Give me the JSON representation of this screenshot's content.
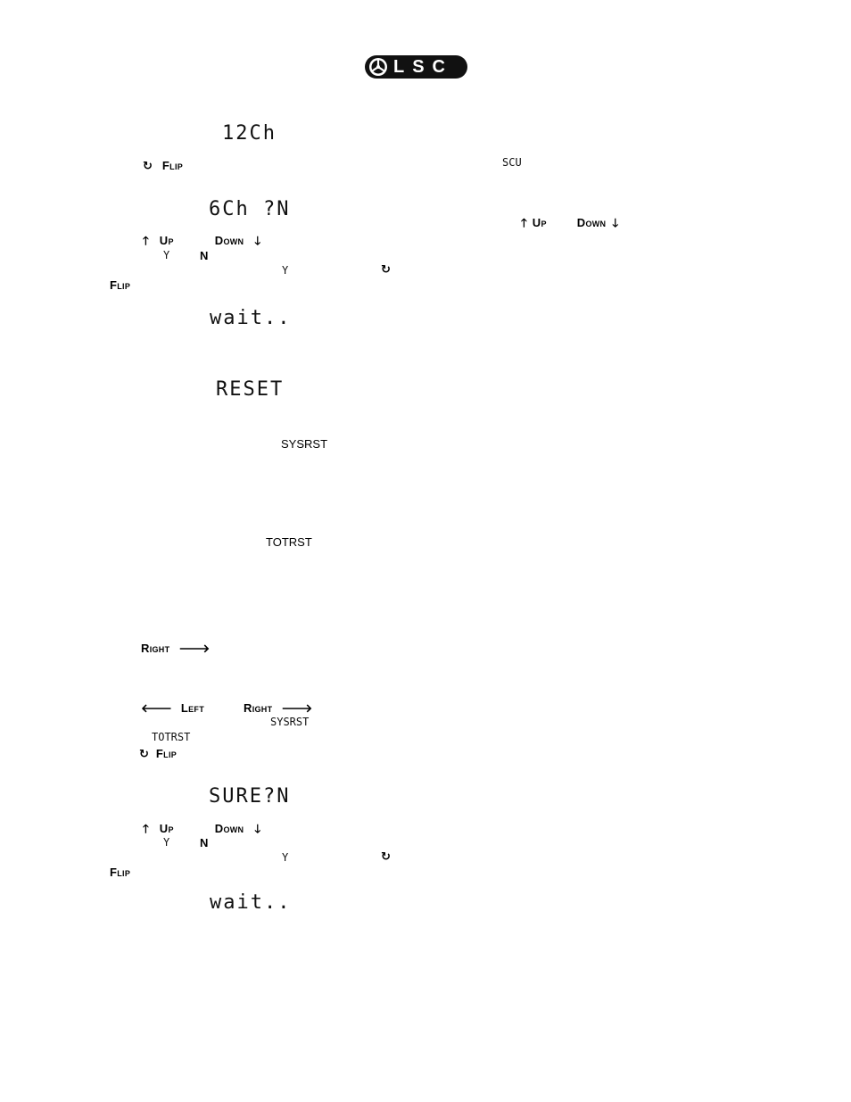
{
  "header": {
    "logo_text": "LSC",
    "logo_icon": "lsc-triskelion-icon"
  },
  "icons": {
    "flip": "↻",
    "up": "🡑",
    "down": "🡓",
    "left": "🡐",
    "right": "🡒"
  },
  "keys": {
    "flip": "Flip",
    "up": "Up",
    "down": "Down",
    "left": "Left",
    "right": "Right"
  },
  "sections": {
    "channel_mode": {
      "display_current": "12Ch",
      "flip_label": "Flip",
      "scu_label": "SCU",
      "display_prompt": "6Ch ?N",
      "up_label": "Up",
      "down_label": "Down",
      "yes": "Y",
      "no": "N",
      "confirm_yes": "Y",
      "flip_label_2": "Flip",
      "display_wait": "wait.."
    },
    "reset": {
      "display_title": "RESET",
      "sysrst_label": "SYSRST",
      "totrst_label": "TOTRST",
      "right_label": "Right",
      "left_label": "Left",
      "right_label_2": "Right",
      "sysrst_label_2": "SYSRST",
      "totrst_label_2": "TOTRST",
      "flip_label": "Flip",
      "display_prompt": "SURE?N",
      "up_label": "Up",
      "down_label": "Down",
      "yes": "Y",
      "no": "N",
      "confirm_yes": "Y",
      "flip_label_2": "Flip",
      "display_wait": "wait.."
    }
  }
}
